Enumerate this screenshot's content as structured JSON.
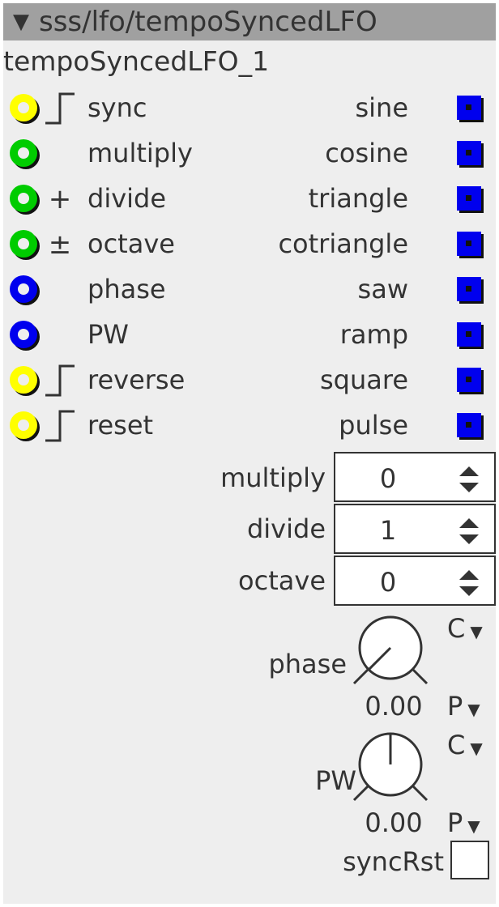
{
  "module": {
    "path": "sss/lfo/tempoSyncedLFO",
    "instance_name": "tempoSyncedLFO_1"
  },
  "colors": {
    "titlebar": "#a0a0a0",
    "panel": "#eeeeee",
    "trigger_jack": "#ffff00",
    "control_jack": "#00cc00",
    "phase_jack": "#0000ee",
    "output_jack": "#0000ee"
  },
  "inputs": [
    {
      "label": "sync",
      "symbol": "⎍",
      "jack": "yellow"
    },
    {
      "label": "multiply",
      "symbol": "",
      "jack": "green"
    },
    {
      "label": "divide",
      "symbol": "+",
      "jack": "green"
    },
    {
      "label": "octave",
      "symbol": "±",
      "jack": "green"
    },
    {
      "label": "phase",
      "symbol": "",
      "jack": "blue"
    },
    {
      "label": "PW",
      "symbol": "",
      "jack": "blue"
    },
    {
      "label": "reverse",
      "symbol": "⎍",
      "jack": "yellow"
    },
    {
      "label": "reset",
      "symbol": "⎍",
      "jack": "yellow"
    }
  ],
  "outputs": [
    {
      "label": "sine"
    },
    {
      "label": "cosine"
    },
    {
      "label": "triangle"
    },
    {
      "label": "cotriangle"
    },
    {
      "label": "saw"
    },
    {
      "label": "ramp"
    },
    {
      "label": "square"
    },
    {
      "label": "pulse"
    }
  ],
  "spinners": [
    {
      "label": "multiply",
      "value": "0"
    },
    {
      "label": "divide",
      "value": "1"
    },
    {
      "label": "octave",
      "value": "0"
    }
  ],
  "knobs": [
    {
      "label": "phase",
      "value": "0.00",
      "value_fraction": 0.0,
      "top_mode": "C",
      "bottom_mode": "P"
    },
    {
      "label": "PW",
      "value": "0.00",
      "value_fraction": 0.5,
      "top_mode": "C",
      "bottom_mode": "P"
    }
  ],
  "checkbox": {
    "label": "syncRst",
    "checked": false
  },
  "icons": {
    "collapse": "triangle-down-icon",
    "dropdown": "triangle-down-small-icon",
    "spinner": "up-down-arrows-icon"
  }
}
